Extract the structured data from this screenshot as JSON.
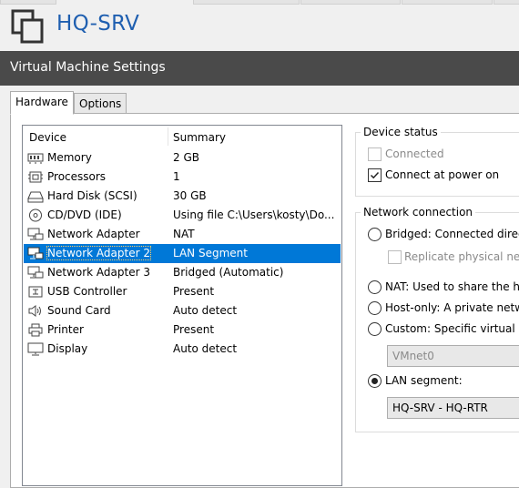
{
  "app": {
    "vm_name": "HQ-SRV"
  },
  "dialog": {
    "title": "Virtual Machine Settings",
    "tabs": [
      {
        "label": "Hardware",
        "active": true
      },
      {
        "label": "Options",
        "active": false
      }
    ]
  },
  "device_list": {
    "columns": [
      "Device",
      "Summary"
    ],
    "rows": [
      {
        "device": "Memory",
        "summary": "2 GB",
        "icon": "memory-icon"
      },
      {
        "device": "Processors",
        "summary": "1",
        "icon": "processor-icon"
      },
      {
        "device": "Hard Disk (SCSI)",
        "summary": "30 GB",
        "icon": "hard-disk-icon"
      },
      {
        "device": "CD/DVD (IDE)",
        "summary": "Using file C:\\Users\\kosty\\Do...",
        "icon": "cd-dvd-icon"
      },
      {
        "device": "Network Adapter",
        "summary": "NAT",
        "icon": "network-adapter-icon"
      },
      {
        "device": "Network Adapter 2",
        "summary": "LAN Segment",
        "icon": "network-adapter-icon",
        "selected": true
      },
      {
        "device": "Network Adapter 3",
        "summary": "Bridged (Automatic)",
        "icon": "network-adapter-icon"
      },
      {
        "device": "USB Controller",
        "summary": "Present",
        "icon": "usb-icon"
      },
      {
        "device": "Sound Card",
        "summary": "Auto detect",
        "icon": "speaker-icon"
      },
      {
        "device": "Printer",
        "summary": "Present",
        "icon": "printer-icon"
      },
      {
        "device": "Display",
        "summary": "Auto detect",
        "icon": "display-icon"
      }
    ]
  },
  "device_status": {
    "title": "Device status",
    "connected": {
      "label": "Connected",
      "checked": false,
      "enabled": false
    },
    "connect_at_power_on": {
      "label": "Connect at power on",
      "checked": true,
      "enabled": true
    }
  },
  "network_connection": {
    "title": "Network connection",
    "bridged": {
      "label": "Bridged: Connected direct",
      "selected": false
    },
    "replicate": {
      "label": "Replicate physical netw",
      "checked": false,
      "enabled": false
    },
    "nat": {
      "label": "NAT: Used to share the ho",
      "selected": false
    },
    "host_only": {
      "label": "Host-only: A private netw",
      "selected": false
    },
    "custom": {
      "label": "Custom: Specific virtual ne",
      "selected": false
    },
    "custom_value": "VMnet0",
    "lan_segment": {
      "label": "LAN segment:",
      "selected": true
    },
    "lan_segment_value": "HQ-SRV - HQ-RTR"
  }
}
